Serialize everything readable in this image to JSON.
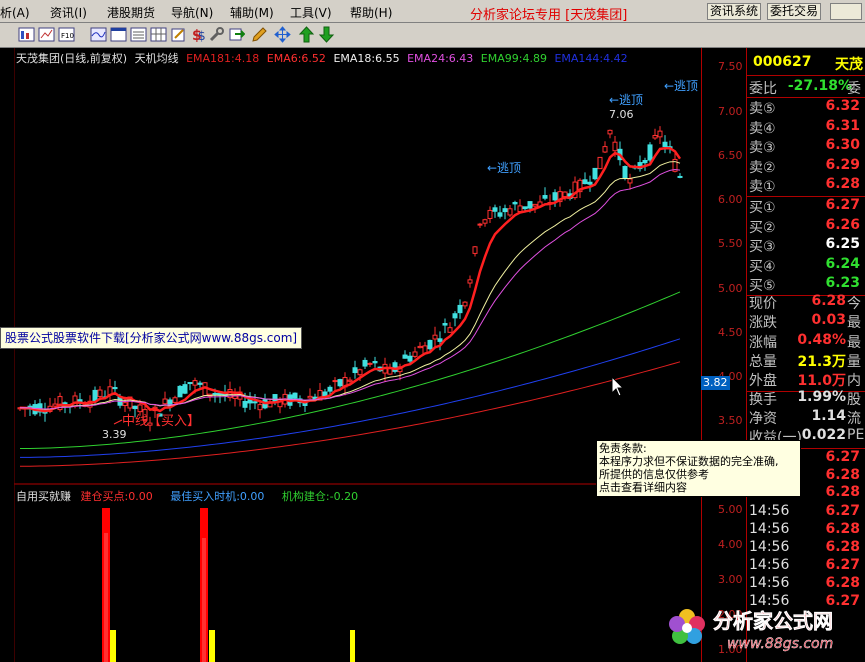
{
  "menu": {
    "items": [
      "析(A)",
      "资讯(I)",
      "港股期货",
      "导航(N)",
      "辅助(M)",
      "工具(V)",
      "帮助(H)"
    ],
    "forum_title": "分析家论坛专用 [天茂集团]",
    "info_button": "资讯系统",
    "trade_button": "委托交易"
  },
  "chart": {
    "stock_title": "天茂集团(日线,前复权)",
    "indicator_name": "天机均线",
    "ema": [
      {
        "label": "EMA181:4.18",
        "color": "#e02020"
      },
      {
        "label": "EMA6:6.52",
        "color": "#ff3030"
      },
      {
        "label": "EMA18:6.55",
        "color": "#f0f0f0"
      },
      {
        "label": "EMA24:6.43",
        "color": "#e050e0"
      },
      {
        "label": "EMA99:4.89",
        "color": "#30d030"
      },
      {
        "label": "EMA144:4.42",
        "color": "#2030e0"
      }
    ],
    "annotations": {
      "escape_top_1": "←逃顶",
      "escape_top_2": "←逃顶",
      "escape_top_3": "←逃顶",
      "high_value": "7.06",
      "low_value": "3.39",
      "buy_signal": "中线【买入】"
    },
    "price_axis": [
      "7.50",
      "7.00",
      "6.50",
      "6.00",
      "5.50",
      "5.00",
      "4.50",
      "4.00",
      "3.50"
    ],
    "current_price_tag": "3.82",
    "indicator_axis": [
      "5.00",
      "4.00",
      "3.00",
      "2.00",
      "1.00"
    ]
  },
  "indicator": {
    "name": "自用买就赚",
    "jiancang": "建仓买点:0.00",
    "best_buy": "最佳买入时机:0.00",
    "institution": "机构建仓:-0.20"
  },
  "promo_text": "股票公式股票软件下载[分析家公式网www.88gs.com]",
  "disclaimer": {
    "title": "免责条款:",
    "lines": [
      "本程序力求但不保证数据的完全准确,",
      "所提供的信息仅供参考",
      "点击查看详细内容"
    ]
  },
  "quote": {
    "code": "000627",
    "name_cut": "天茂",
    "weibi_label": "委比",
    "weibi_value": "-27.18%",
    "weibi_cut": "委",
    "sells": [
      {
        "label": "卖⑤",
        "price": "6.32"
      },
      {
        "label": "卖④",
        "price": "6.31"
      },
      {
        "label": "卖③",
        "price": "6.30"
      },
      {
        "label": "卖②",
        "price": "6.29"
      },
      {
        "label": "卖①",
        "price": "6.28"
      }
    ],
    "buys": [
      {
        "label": "买①",
        "price": "6.27",
        "color": "#ff3030"
      },
      {
        "label": "买②",
        "price": "6.26",
        "color": "#ff3030"
      },
      {
        "label": "买③",
        "price": "6.25",
        "color": "#ffffff"
      },
      {
        "label": "买④",
        "price": "6.24",
        "color": "#30e030"
      },
      {
        "label": "买⑤",
        "price": "6.23",
        "color": "#30e030"
      }
    ],
    "stats": [
      {
        "label": "现价",
        "value": "6.28",
        "cut": "今",
        "color": "#ff3030"
      },
      {
        "label": "涨跌",
        "value": "0.03",
        "cut": "最",
        "color": "#ff3030"
      },
      {
        "label": "涨幅",
        "value": "0.48%",
        "cut": "最",
        "color": "#ff3030"
      },
      {
        "label": "总量",
        "value": "21.3万",
        "cut": "量",
        "color": "#ffff00"
      },
      {
        "label": "外盘",
        "value": "11.0万",
        "cut": "内",
        "color": "#ff3030"
      }
    ],
    "stats2": [
      {
        "label": "换手",
        "value": "1.99%",
        "cut": "股",
        "color": "#e0e0e0"
      },
      {
        "label": "净资",
        "value": "1.14",
        "cut": "流",
        "color": "#e0e0e0"
      },
      {
        "label": "收益(一)",
        "value": "0.022",
        "cut": "PE",
        "color": "#e0e0e0"
      }
    ],
    "ticks_top": [
      "6.27",
      "6.28",
      "6.28"
    ],
    "ticks": [
      {
        "time": "14:56",
        "price": "6.27"
      },
      {
        "time": "14:56",
        "price": "6.28"
      },
      {
        "time": "14:56",
        "price": "6.28"
      },
      {
        "time": "14:56",
        "price": "6.27"
      },
      {
        "time": "14:56",
        "price": "6.28"
      },
      {
        "time": "14:56",
        "price": "6.27"
      }
    ]
  },
  "watermark": {
    "name": "分析家公式网",
    "url": "www.88gs.com"
  }
}
